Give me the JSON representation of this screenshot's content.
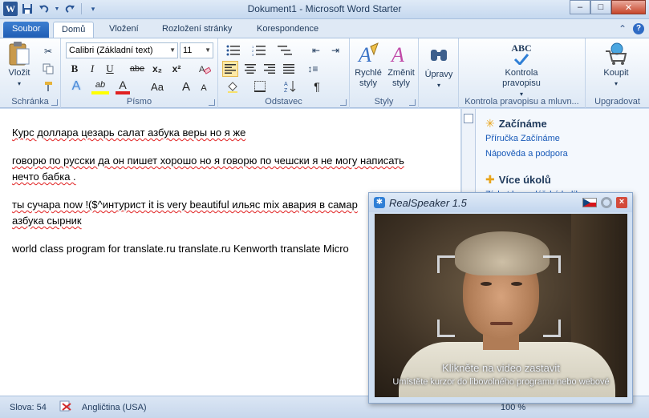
{
  "window": {
    "title": "Dokument1  -  Microsoft Word Starter",
    "minimize": "–",
    "maximize": "□",
    "close": "✕"
  },
  "qat": {
    "app_icon": "W",
    "icons": [
      "save-icon",
      "undo-icon",
      "redo-icon",
      "customize-icon"
    ]
  },
  "tabs": [
    {
      "label": "Soubor"
    },
    {
      "label": "Domů"
    },
    {
      "label": "Vložení"
    },
    {
      "label": "Rozložení stránky"
    },
    {
      "label": "Korespondence"
    }
  ],
  "ribbon": {
    "clipboard": {
      "label": "Schránka",
      "paste": "Vložit"
    },
    "font": {
      "label": "Písmo",
      "font_name": "Calibri (Základní text)",
      "font_size": "11",
      "bold": "B",
      "italic": "I",
      "underline": "U",
      "strike": "abe",
      "subscript": "x₂",
      "superscript": "x²",
      "text_effects": "A",
      "highlight": "ab",
      "font_color": "A",
      "change_case": "Aa",
      "grow": "A",
      "shrink": "A"
    },
    "paragraph": {
      "label": "Odstavec",
      "show_marks": "¶"
    },
    "styles": {
      "label": "Styly",
      "quick_styles": "Rychlé styly",
      "change_styles": "Změnit styly"
    },
    "editing": {
      "label": "Úpravy"
    },
    "proofing": {
      "label": "Kontrola pravopisu a mluvn...",
      "button": "Kontrola pravopisu",
      "abc": "ABC"
    },
    "upgrade": {
      "label": "Upgradovat",
      "button": "Koupit"
    }
  },
  "document": {
    "lines": [
      "Курс доллара цезарь салат азбука веры но я же",
      "говорю по русски да он пишет хорошо но я говорю по чешски я не могу написать",
      "нечто бабка .",
      "ты сучара now !($^интурист it is very beautiful ильяс mix авария в самар",
      "азбука сырник",
      "world class program for translate.ru translate.ru Kenworth translate Micro"
    ]
  },
  "task_pane": {
    "heading1": "Začínáme",
    "link1": "Příručka Začínáme",
    "link2": "Nápověda a podpora",
    "heading2": "Více úkolů",
    "link3": "Získat kancelářské balíky"
  },
  "status_bar": {
    "words": "Slova: 54",
    "language": "Angličtina (USA)",
    "zoom": "100 %"
  },
  "realspeaker": {
    "title": "RealSpeaker 1.5",
    "video_hint1": "Klikněte na video zastavit",
    "video_hint2": "Umístěte kurzor do libovolného programu nebo webové"
  },
  "colors": {
    "accent": "#2b5797",
    "file_tab": "#1e5cb3",
    "ribbon_bg": "#dde8f5",
    "spell_underline": "#e02020"
  }
}
